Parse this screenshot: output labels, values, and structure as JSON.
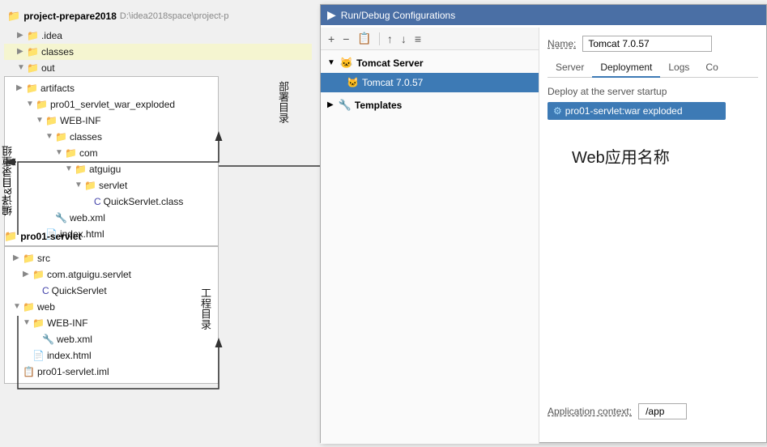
{
  "leftPanel": {
    "projectName": "project-prepare2018",
    "projectPath": "D:\\idea2018space\\project-p",
    "tree": {
      "items": [
        {
          "indent": 0,
          "arrow": "▶",
          "icon": "📁",
          "iconClass": "folder-yellow",
          "label": ".idea"
        },
        {
          "indent": 0,
          "arrow": "▶",
          "icon": "📁",
          "iconClass": "folder-orange",
          "label": "classes"
        },
        {
          "indent": 0,
          "arrow": "▼",
          "icon": "📁",
          "iconClass": "folder-yellow",
          "label": "out"
        }
      ]
    },
    "box1": {
      "items": [
        {
          "indent": 2,
          "arrow": "▶",
          "icon": "📁",
          "iconClass": "folder-yellow",
          "label": "artifacts"
        },
        {
          "indent": 4,
          "arrow": "▼",
          "icon": "📁",
          "iconClass": "folder-blue",
          "label": "pro01_servlet_war_exploded"
        },
        {
          "indent": 6,
          "arrow": "▼",
          "icon": "📁",
          "iconClass": "folder-blue",
          "label": "WEB-INF"
        },
        {
          "indent": 8,
          "arrow": "▼",
          "icon": "📁",
          "iconClass": "folder-blue",
          "label": "classes"
        },
        {
          "indent": 10,
          "arrow": "▼",
          "icon": "📁",
          "iconClass": "folder-blue",
          "label": "com"
        },
        {
          "indent": 12,
          "arrow": "▼",
          "icon": "📁",
          "iconClass": "folder-blue",
          "label": "atguigu"
        },
        {
          "indent": 14,
          "arrow": "▼",
          "icon": "📁",
          "iconClass": "folder-blue",
          "label": "servlet"
        },
        {
          "indent": 16,
          "arrow": "",
          "icon": "C",
          "iconClass": "file-class",
          "label": "QuickServlet.class"
        },
        {
          "indent": 8,
          "arrow": "",
          "icon": "🔧",
          "iconClass": "file-xml",
          "label": "web.xml"
        },
        {
          "indent": 6,
          "arrow": "",
          "icon": "📄",
          "iconClass": "file-html",
          "label": "index.html"
        }
      ]
    },
    "box2": {
      "items": [
        {
          "indent": 0,
          "arrow": "▶",
          "icon": "📁",
          "iconClass": "folder-blue",
          "label": "src"
        },
        {
          "indent": 2,
          "arrow": "▶",
          "icon": "📁",
          "iconClass": "folder-blue",
          "label": "com.atguigu.servlet"
        },
        {
          "indent": 4,
          "arrow": "",
          "icon": "C",
          "iconClass": "file-class",
          "label": "QuickServlet"
        },
        {
          "indent": 0,
          "arrow": "▼",
          "icon": "📁",
          "iconClass": "folder-blue",
          "label": "web"
        },
        {
          "indent": 2,
          "arrow": "▼",
          "icon": "📁",
          "iconClass": "folder-blue",
          "label": "WEB-INF"
        },
        {
          "indent": 4,
          "arrow": "",
          "icon": "🔧",
          "iconClass": "file-xml",
          "label": "web.xml"
        },
        {
          "indent": 2,
          "arrow": "",
          "icon": "📄",
          "iconClass": "file-html",
          "label": "index.html"
        },
        {
          "indent": 0,
          "arrow": "",
          "icon": "📋",
          "iconClass": "file-xml",
          "label": "pro01-servlet.iml"
        }
      ]
    },
    "annotations": {
      "compileLabel": "编译&目录重组",
      "deployDirLabel": "部署目录",
      "projectDirLabel": "工程目录",
      "deployArrow": "部署"
    },
    "projectName2": "pro01-servlet"
  },
  "rightPanel": {
    "title": "Run/Debug Configurations",
    "titleIcon": "🏃",
    "toolbar": {
      "add": "+",
      "remove": "−",
      "copy": "📋",
      "moveUp": "↑",
      "moveDown": "↓",
      "sort": "≡"
    },
    "tree": {
      "tomcatServer": {
        "label": "Tomcat Server",
        "icon": "🐱",
        "child": "Tomcat 7.0.57"
      },
      "templates": {
        "label": "Templates",
        "icon": "🔧"
      }
    },
    "nameLabel": "Name:",
    "nameValue": "Tomcat 7.0.57",
    "tabs": [
      "Server",
      "Deployment",
      "Logs",
      "Co"
    ],
    "activeTab": "Deployment",
    "deploySection": {
      "title": "Deploy at the server startup",
      "item": "pro01-servlet:war exploded",
      "itemIcon": "⚙"
    },
    "webAppName": "Web应用名称",
    "appContextLabel": "Application context:",
    "appContextValue": "/app"
  }
}
